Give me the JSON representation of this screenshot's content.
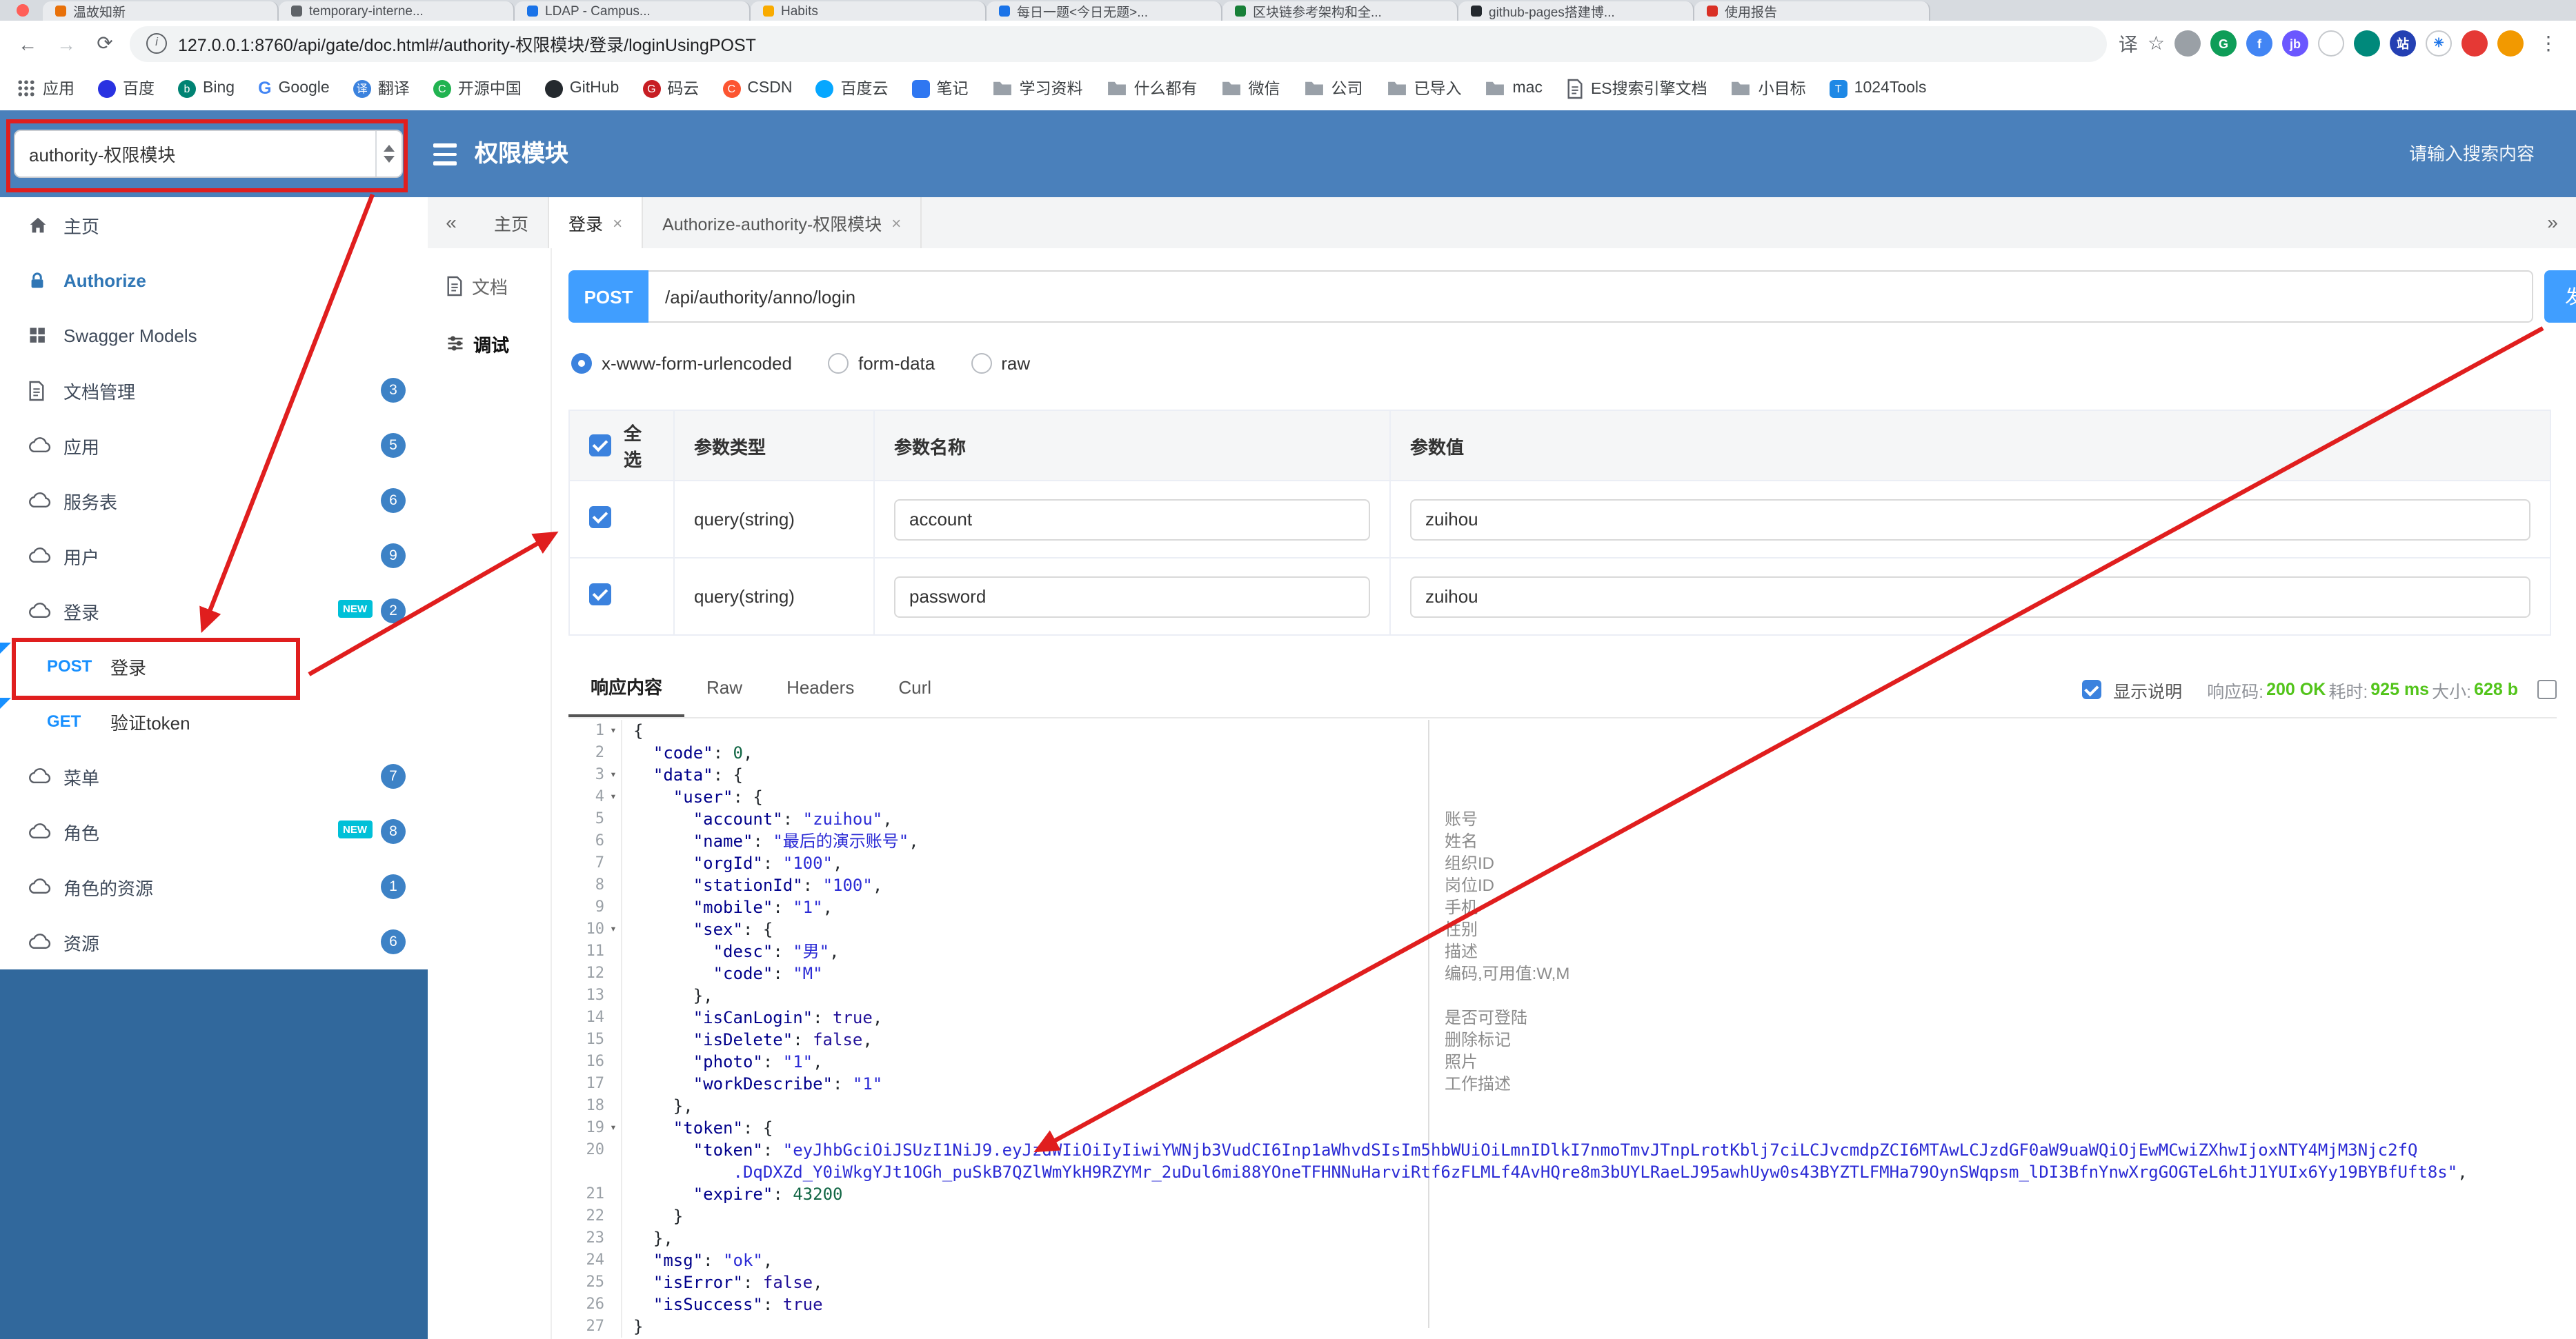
{
  "colors": {
    "accent": "#409eff",
    "header_blue": "#4a80bb",
    "badge_blue": "#3d82c6",
    "sidebar_fill": "#31689c",
    "success_green": "#52c41a",
    "annotation_red": "#e01e1e",
    "method_blue": "#1890ff"
  },
  "browser": {
    "url": "127.0.0.1:8760/api/gate/doc.html#/authority-权限模块/登录/loginUsingPOST",
    "tabs": [
      {
        "title": "温故知新",
        "color": "#e8710a"
      },
      {
        "title": "temporary-interne...",
        "color": "#5f6368"
      },
      {
        "title": "LDAP - Campus...",
        "color": "#1a73e8"
      },
      {
        "title": "Habits",
        "color": "#f9ab00"
      },
      {
        "title": "每日一题<今日无题>...",
        "color": "#1a73e8"
      },
      {
        "title": "区块链参考架构和全...",
        "color": "#188038"
      },
      {
        "title": "github-pages搭建博...",
        "color": "#24292e"
      },
      {
        "title": "使用报告",
        "color": "#d93025"
      }
    ],
    "toolbar_icons": [
      {
        "k": "plain",
        "g": "译",
        "n": "translate-icon"
      },
      {
        "k": "plain",
        "g": "☆",
        "n": "bookmark-star-icon"
      },
      {
        "k": "dot",
        "g": "",
        "bg": "#9aa0a6",
        "n": "extension-icon"
      },
      {
        "k": "dot",
        "g": "G",
        "bg": "#0f9d58",
        "n": "extension-icon"
      },
      {
        "k": "dot",
        "g": "f",
        "bg": "#4285f4",
        "n": "extension-icon"
      },
      {
        "k": "dot",
        "g": "jb",
        "bg": "#6b57ff",
        "n": "extension-icon"
      },
      {
        "k": "dot",
        "g": "",
        "bg": "#ffffff",
        "bd": "#c6c9cd",
        "fg": "#333",
        "n": "extension-icon"
      },
      {
        "k": "dot",
        "g": "",
        "bg": "#00897b",
        "n": "shield-extension-icon"
      },
      {
        "k": "dot",
        "g": "站",
        "bg": "#2440b3",
        "n": "extension-icon"
      },
      {
        "k": "dot",
        "g": "✳",
        "bg": "#ffffff",
        "fg": "#1a73e8",
        "bd": "#c6c9cd",
        "n": "extension-icon"
      },
      {
        "k": "dot",
        "g": "",
        "bg": "#e53935",
        "n": "extension-icon"
      },
      {
        "k": "dot",
        "g": "",
        "bg": "#f29900",
        "n": "profile-avatar"
      }
    ],
    "bookmarks": [
      {
        "label": "应用",
        "icon": "apps"
      },
      {
        "label": "百度",
        "icon": "dot",
        "bg": "#2932e1"
      },
      {
        "label": "Bing",
        "icon": "dot",
        "bg": "#008373",
        "glyph": "b"
      },
      {
        "label": "Google",
        "icon": "glyph",
        "glyph": "G",
        "fg": "#4285f4"
      },
      {
        "label": "翻译",
        "icon": "dot",
        "bg": "#3b82de",
        "glyph": "译"
      },
      {
        "label": "开源中国",
        "icon": "dot",
        "bg": "#21b351",
        "glyph": "C"
      },
      {
        "label": "GitHub",
        "icon": "dot",
        "bg": "#24292e"
      },
      {
        "label": "码云",
        "icon": "dot",
        "bg": "#c71d23",
        "glyph": "G"
      },
      {
        "label": "CSDN",
        "icon": "dot",
        "bg": "#fc5531",
        "glyph": "C"
      },
      {
        "label": "百度云",
        "icon": "dot",
        "bg": "#06a7ff"
      },
      {
        "label": "笔记",
        "icon": "square",
        "bg": "#2f77f1"
      },
      {
        "label": "学习资料",
        "icon": "folder"
      },
      {
        "label": "什么都有",
        "icon": "folder"
      },
      {
        "label": "微信",
        "icon": "folder"
      },
      {
        "label": "公司",
        "icon": "folder"
      },
      {
        "label": "已导入",
        "icon": "folder"
      },
      {
        "label": "mac",
        "icon": "folder"
      },
      {
        "label": "ES搜索引擎文档",
        "icon": "doc"
      },
      {
        "label": "小目标",
        "icon": "folder"
      },
      {
        "label": "1024Tools",
        "icon": "square",
        "bg": "#1e88e5",
        "glyph": "T"
      }
    ]
  },
  "header": {
    "group_select": "authority-权限模块",
    "title": "权限模块",
    "search_placeholder": "请输入搜索内容"
  },
  "sidebar": {
    "items": [
      {
        "id": "home",
        "label": "主页",
        "icon": "home"
      },
      {
        "id": "authorize",
        "label": "Authorize",
        "icon": "lock"
      },
      {
        "id": "swagger-models",
        "label": "Swagger Models",
        "icon": "grid"
      },
      {
        "id": "doc-manage",
        "label": "文档管理",
        "icon": "doc",
        "badge": "3"
      },
      {
        "id": "app",
        "label": "应用",
        "icon": "cloud",
        "badge": "5"
      },
      {
        "id": "service",
        "label": "服务表",
        "icon": "cloud",
        "badge": "6"
      },
      {
        "id": "user",
        "label": "用户",
        "icon": "cloud",
        "badge": "9"
      },
      {
        "id": "login",
        "label": "登录",
        "icon": "cloud",
        "badge": "2",
        "new": true
      },
      {
        "id": "post-login",
        "label": "登录",
        "method": "POST"
      },
      {
        "id": "get-verify-token",
        "label": "验证token",
        "method": "GET"
      },
      {
        "id": "menu",
        "label": "菜单",
        "icon": "cloud",
        "badge": "7"
      },
      {
        "id": "role",
        "label": "角色",
        "icon": "cloud",
        "badge": "8",
        "new": true
      },
      {
        "id": "role-resource",
        "label": "角色的资源",
        "icon": "cloud",
        "badge": "1"
      },
      {
        "id": "resource",
        "label": "资源",
        "icon": "cloud",
        "badge": "6"
      }
    ]
  },
  "tabs_bar": {
    "tabs": [
      {
        "label": "主页",
        "closable": false
      },
      {
        "label": "登录",
        "closable": true,
        "active": true
      },
      {
        "label": "Authorize-authority-权限模块",
        "closable": true
      }
    ]
  },
  "doc_nav": {
    "items": [
      {
        "label": "文档",
        "icon": "doc"
      },
      {
        "label": "调试",
        "icon": "debug",
        "active": true
      }
    ]
  },
  "debug": {
    "method": "POST",
    "path": "/api/authority/anno/login",
    "send_label": "发",
    "content_types": [
      {
        "label": "x-www-form-urlencoded",
        "selected": true
      },
      {
        "label": "form-data"
      },
      {
        "label": "raw"
      }
    ],
    "param_table": {
      "headers": [
        "全选",
        "参数类型",
        "参数名称",
        "参数值"
      ],
      "rows": [
        {
          "checked": true,
          "type": "query(string)",
          "name": "account",
          "value": "zuihou"
        },
        {
          "checked": true,
          "type": "query(string)",
          "name": "password",
          "value": "zuihou"
        }
      ]
    },
    "response_tabs": [
      {
        "label": "响应内容",
        "active": true
      },
      {
        "label": "Raw"
      },
      {
        "label": "Headers"
      },
      {
        "label": "Curl"
      }
    ],
    "show_desc_label": "显示说明",
    "status": {
      "code_label": "响应码:",
      "code": "200 OK",
      "time_label": "耗时:",
      "time": "925 ms",
      "size_label": "大小:",
      "size": "628 b"
    }
  },
  "response": {
    "lines": [
      {
        "n": 1,
        "fold": true,
        "t": [
          [
            "p",
            "{"
          ]
        ]
      },
      {
        "n": 2,
        "t": [
          [
            "k",
            "  \"code\""
          ],
          [
            "p",
            ": "
          ],
          [
            "n",
            "0"
          ],
          [
            "p",
            ","
          ]
        ]
      },
      {
        "n": 3,
        "fold": true,
        "t": [
          [
            "k",
            "  \"data\""
          ],
          [
            "p",
            ": {"
          ]
        ]
      },
      {
        "n": 4,
        "fold": true,
        "t": [
          [
            "k",
            "    \"user\""
          ],
          [
            "p",
            ": {"
          ]
        ]
      },
      {
        "n": 5,
        "t": [
          [
            "k",
            "      \"account\""
          ],
          [
            "p",
            ": "
          ],
          [
            "s",
            "\"zuihou\""
          ],
          [
            "p",
            ","
          ]
        ]
      },
      {
        "n": 6,
        "t": [
          [
            "k",
            "      \"name\""
          ],
          [
            "p",
            ": "
          ],
          [
            "s",
            "\"最后的演示账号\""
          ],
          [
            "p",
            ","
          ]
        ]
      },
      {
        "n": 7,
        "t": [
          [
            "k",
            "      \"orgId\""
          ],
          [
            "p",
            ": "
          ],
          [
            "s",
            "\"100\""
          ],
          [
            "p",
            ","
          ]
        ]
      },
      {
        "n": 8,
        "t": [
          [
            "k",
            "      \"stationId\""
          ],
          [
            "p",
            ": "
          ],
          [
            "s",
            "\"100\""
          ],
          [
            "p",
            ","
          ]
        ]
      },
      {
        "n": 9,
        "t": [
          [
            "k",
            "      \"mobile\""
          ],
          [
            "p",
            ": "
          ],
          [
            "s",
            "\"1\""
          ],
          [
            "p",
            ","
          ]
        ]
      },
      {
        "n": 10,
        "fold": true,
        "t": [
          [
            "k",
            "      \"sex\""
          ],
          [
            "p",
            ": {"
          ]
        ]
      },
      {
        "n": 11,
        "t": [
          [
            "k",
            "        \"desc\""
          ],
          [
            "p",
            ": "
          ],
          [
            "s",
            "\"男\""
          ],
          [
            "p",
            ","
          ]
        ]
      },
      {
        "n": 12,
        "t": [
          [
            "k",
            "        \"code\""
          ],
          [
            "p",
            ": "
          ],
          [
            "s",
            "\"M\""
          ]
        ]
      },
      {
        "n": 13,
        "t": [
          [
            "p",
            "      },"
          ]
        ]
      },
      {
        "n": 14,
        "t": [
          [
            "k",
            "      \"isCanLogin\""
          ],
          [
            "p",
            ": "
          ],
          [
            "b",
            "true"
          ],
          [
            "p",
            ","
          ]
        ]
      },
      {
        "n": 15,
        "t": [
          [
            "k",
            "      \"isDelete\""
          ],
          [
            "p",
            ": "
          ],
          [
            "b",
            "false"
          ],
          [
            "p",
            ","
          ]
        ]
      },
      {
        "n": 16,
        "t": [
          [
            "k",
            "      \"photo\""
          ],
          [
            "p",
            ": "
          ],
          [
            "s",
            "\"1\""
          ],
          [
            "p",
            ","
          ]
        ]
      },
      {
        "n": 17,
        "t": [
          [
            "k",
            "      \"workDescribe\""
          ],
          [
            "p",
            ": "
          ],
          [
            "s",
            "\"1\""
          ]
        ]
      },
      {
        "n": 18,
        "t": [
          [
            "p",
            "    },"
          ]
        ]
      },
      {
        "n": 19,
        "fold": true,
        "t": [
          [
            "k",
            "    \"token\""
          ],
          [
            "p",
            ": {"
          ]
        ]
      },
      {
        "n": 20,
        "t": [
          [
            "k",
            "      \"token\""
          ],
          [
            "p",
            ": "
          ],
          [
            "s",
            "\"eyJhbGciOiJSUzI1NiJ9.eyJzdWIiOiIyIiwiYWNjb3VudCI6Inp1aWhvdSIsIm5hbWUiOiLmnIDlkI7nmoTmvJTnpLrotKblj7ciLCJvcmdpZCI6MTAwLCJzdGF0aW9uaWQiOjEwMCwiZXhwIjoxNTY4MjM3Njc2fQ"
          ]
        ],
        "wrap": [
          [
            "s",
            "          .DqDXZd_Y0iWkgYJt1OGh_puSkB7QZlWmYkH9RZYMr_2uDul6mi88YOneTFHNNuHarviRtf6zFLMLf4AvHQre8m3bUYLRaeLJ95awhUyw0s43BYZTLFMHa79OynSWqpsm_lDI3BfnYnwXrgGOGTeL6htJ1YUIx6Yy19BYBfUft8s\""
          ],
          [
            "p",
            ","
          ]
        ]
      },
      {
        "n": 21,
        "t": [
          [
            "k",
            "      \"expire\""
          ],
          [
            "p",
            ": "
          ],
          [
            "n",
            "43200"
          ]
        ]
      },
      {
        "n": 22,
        "t": [
          [
            "p",
            "    }"
          ]
        ]
      },
      {
        "n": 23,
        "t": [
          [
            "p",
            "  },"
          ]
        ]
      },
      {
        "n": 24,
        "t": [
          [
            "k",
            "  \"msg\""
          ],
          [
            "p",
            ": "
          ],
          [
            "s",
            "\"ok\""
          ],
          [
            "p",
            ","
          ]
        ]
      },
      {
        "n": 25,
        "t": [
          [
            "k",
            "  \"isError\""
          ],
          [
            "p",
            ": "
          ],
          [
            "b",
            "false"
          ],
          [
            "p",
            ","
          ]
        ]
      },
      {
        "n": 26,
        "t": [
          [
            "k",
            "  \"isSuccess\""
          ],
          [
            "p",
            ": "
          ],
          [
            "b",
            "true"
          ]
        ]
      },
      {
        "n": 27,
        "t": [
          [
            "p",
            "}"
          ]
        ]
      }
    ],
    "annotations": {
      "5": "账号",
      "6": "姓名",
      "7": "组织ID",
      "8": "岗位ID",
      "9": "手机",
      "10": "性别",
      "11": "描述",
      "12": "编码,可用值:W,M",
      "14": "是否可登陆",
      "15": "删除标记",
      "16": "照片",
      "17": "工作描述"
    }
  }
}
